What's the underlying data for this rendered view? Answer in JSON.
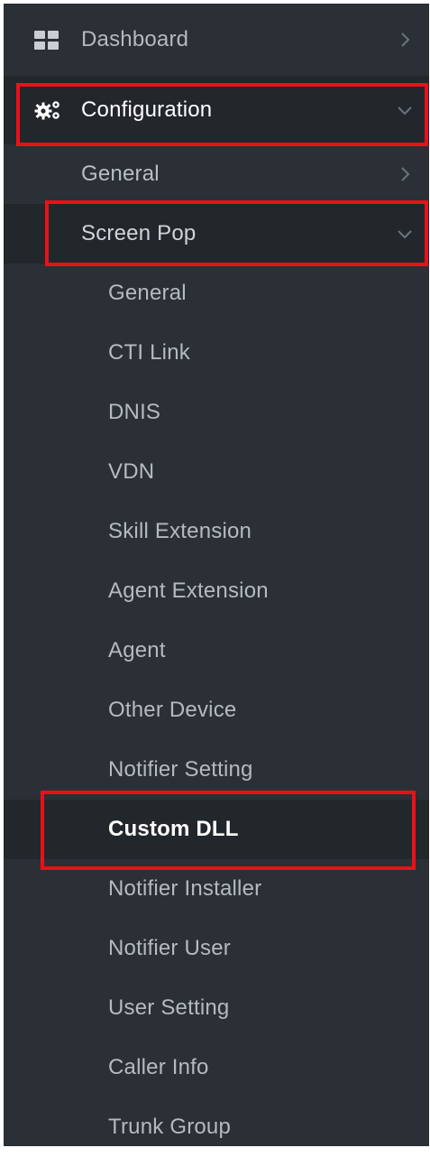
{
  "sidebar": {
    "items": [
      {
        "label": "Dashboard",
        "icon": "dashboard-grid-icon",
        "chevron": "chevron-right"
      },
      {
        "label": "Configuration",
        "icon": "cogs-icon",
        "chevron": "chevron-down"
      }
    ],
    "configuration": {
      "children": [
        {
          "label": "General",
          "chevron": "chevron-right"
        },
        {
          "label": "Screen Pop",
          "chevron": "chevron-down"
        }
      ],
      "screen_pop": {
        "children": [
          {
            "label": "General"
          },
          {
            "label": "CTI Link"
          },
          {
            "label": "DNIS"
          },
          {
            "label": "VDN"
          },
          {
            "label": "Skill Extension"
          },
          {
            "label": "Agent Extension"
          },
          {
            "label": "Agent"
          },
          {
            "label": "Other Device"
          },
          {
            "label": "Notifier Setting"
          },
          {
            "label": "Custom DLL"
          },
          {
            "label": "Notifier Installer"
          },
          {
            "label": "Notifier User"
          },
          {
            "label": "User Setting"
          },
          {
            "label": "Caller Info"
          },
          {
            "label": "Trunk Group"
          }
        ]
      }
    },
    "colors": {
      "background": "#2a3036",
      "active_background": "#22272c",
      "highlight_border": "#e8111a",
      "text": "#b8bec4",
      "text_active": "#ffffff"
    }
  }
}
